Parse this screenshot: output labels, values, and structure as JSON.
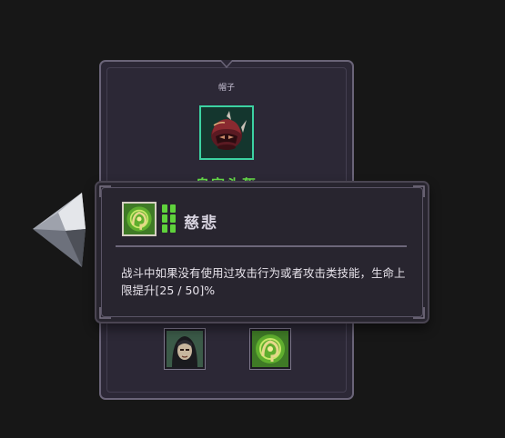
{
  "item_card": {
    "slot_label": "帽子",
    "item_name": "皇家头盔",
    "item_icon": "royal-helmet-icon",
    "portraits": [
      {
        "icon": "hooded-character-icon"
      },
      {
        "icon": "green-rune-icon"
      }
    ]
  },
  "tooltip": {
    "skill_icon": "green-rune-icon",
    "title": "慈悲",
    "description": "战斗中如果没有使用过攻击行为或者攻击类技能，生命上限提升[25 / 50]%",
    "level_pips": 4,
    "pip_color": "#5fd23c"
  },
  "colors": {
    "background": "#171717",
    "panel": "#2c2836",
    "tooltip": "#28252f",
    "rarity_green": "#67e04a",
    "frame_teal": "#3cd2a2"
  }
}
